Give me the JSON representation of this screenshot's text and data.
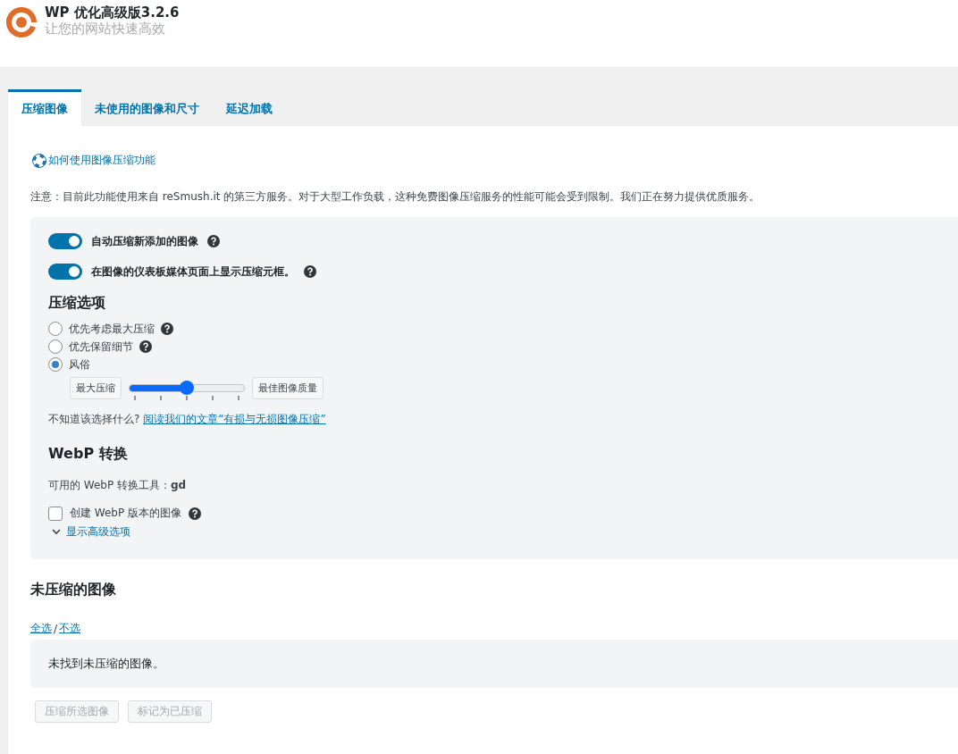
{
  "header": {
    "title": "WP 优化高级版3.2.6",
    "subtitle": "让您的网站快速高效"
  },
  "tabs": [
    {
      "label": "压缩图像",
      "selected": true
    },
    {
      "label": "未使用的图像和尺寸",
      "selected": false
    },
    {
      "label": "延迟加载",
      "selected": false
    }
  ],
  "help_link": "如何使用图像压缩功能",
  "notice": "注意：目前此功能使用来自 reSmush.it 的第三方服务。对于大型工作负载，这种免费图像压缩服务的性能可能会受到限制。我们正在努力提供优质服务。",
  "toggles": [
    {
      "label": "自动压缩新添加的图像",
      "on": true
    },
    {
      "label": "在图像的仪表板媒体页面上显示压缩元框。",
      "on": true
    }
  ],
  "compression": {
    "heading": "压缩选项",
    "options": [
      {
        "label": "优先考虑最大压缩",
        "selected": false,
        "help": true
      },
      {
        "label": "优先保留细节",
        "selected": false,
        "help": true
      },
      {
        "label": "风俗",
        "selected": true,
        "help": false
      }
    ],
    "slider": {
      "min_label": "最大压缩",
      "max_label": "最佳图像质量",
      "level": 0.5
    },
    "hint": "不知道该选择什么?",
    "article_link": "阅读我们的文章“有损与无损图像压缩”"
  },
  "webp": {
    "heading": "WebP 转换",
    "tool_text": "可用的 WebP 转换工具：**gd**",
    "checkbox": {
      "label": "创建 WebP 版本的图像",
      "checked": false
    },
    "advanced_link": "显示高级选项"
  },
  "uncompressed": {
    "heading": "未压缩的图像",
    "select_all": "全选",
    "separator": "/",
    "select_none": "不选",
    "empty_message": "未找到未压缩的图像。",
    "buttons": [
      {
        "label": "压缩所选图像",
        "disabled": true
      },
      {
        "label": "标记为已压缩",
        "disabled": true
      }
    ]
  }
}
